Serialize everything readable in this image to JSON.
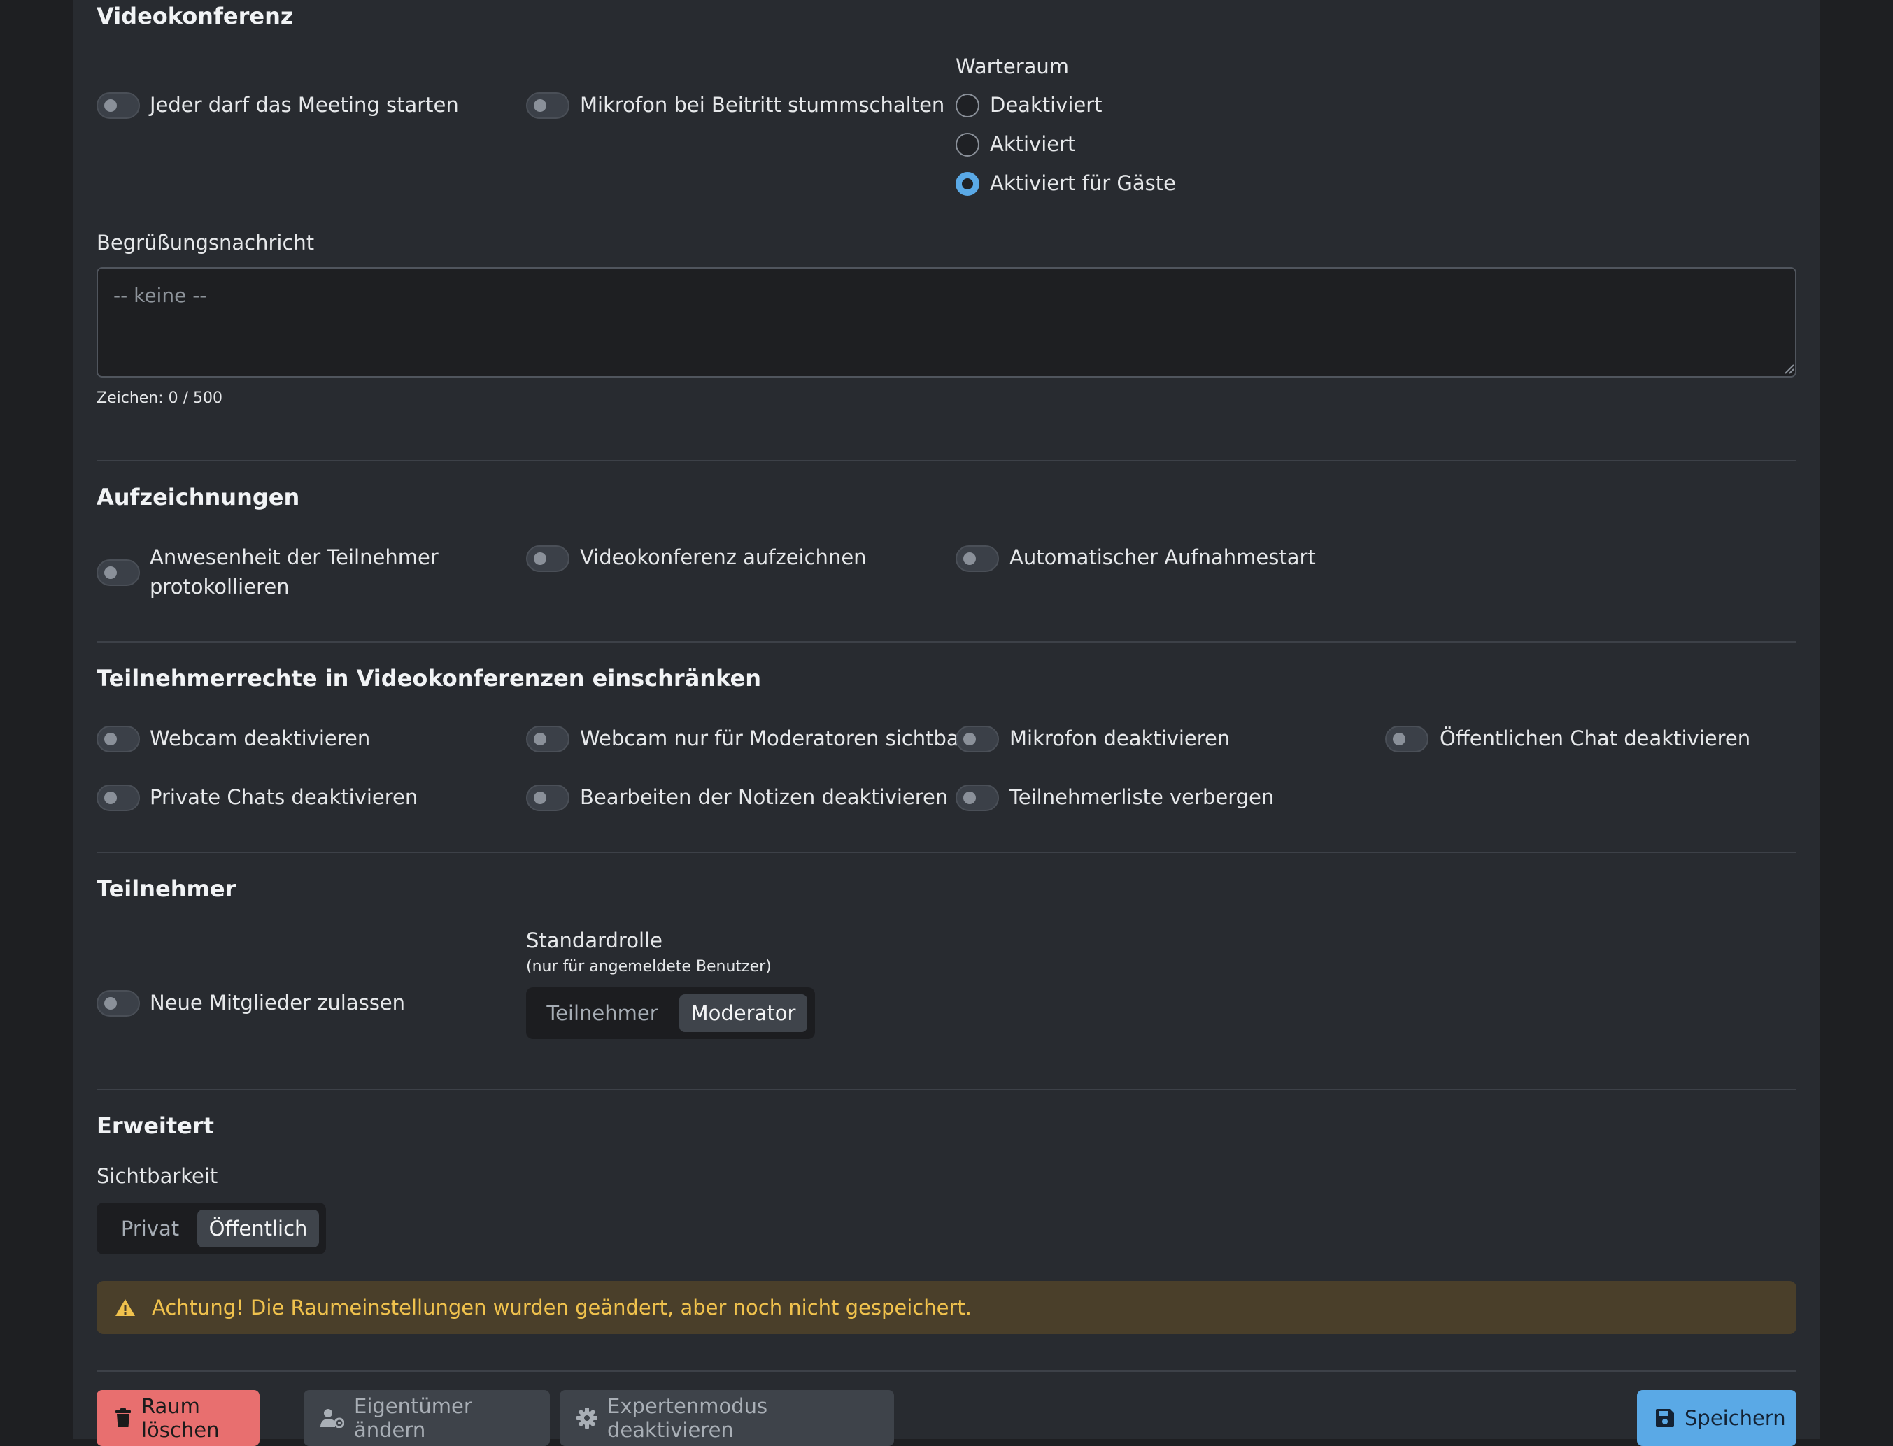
{
  "sections": {
    "videokonferenz": {
      "title": "Videokonferenz",
      "toggle_anyone_start": "Jeder darf das Meeting starten",
      "toggle_mute_on_join": "Mikrofon bei Beitritt stummschalten",
      "waiting_room": {
        "label": "Warteraum",
        "options": [
          "Deaktiviert",
          "Aktiviert",
          "Aktiviert für Gäste"
        ],
        "selected": "Aktiviert für Gäste"
      },
      "welcome": {
        "label": "Begrüßungsnachricht",
        "placeholder": "-- keine --",
        "value": "",
        "counter": "Zeichen: 0 / 500"
      }
    },
    "recordings": {
      "title": "Aufzeichnungen",
      "toggle_attendance_line1": "Anwesenheit der Teilnehmer",
      "toggle_attendance_line2": "protokollieren",
      "toggle_record": "Videokonferenz aufzeichnen",
      "toggle_auto_start": "Automatischer Aufnahmestart"
    },
    "restrictions": {
      "title": "Teilnehmerrechte in Videokonferenzen einschränken",
      "items": [
        "Webcam deaktivieren",
        "Webcam nur für Moderatoren sichtbar",
        "Mikrofon deaktivieren",
        "Öffentlichen Chat deaktivieren",
        "Private Chats deaktivieren",
        "Bearbeiten der Notizen deaktivieren",
        "Teilnehmerliste verbergen"
      ]
    },
    "participants": {
      "title": "Teilnehmer",
      "toggle_new_members": "Neue Mitglieder zulassen",
      "default_role_label": "Standardrolle",
      "default_role_hint": "(nur für angemeldete Benutzer)",
      "role_options": [
        "Teilnehmer",
        "Moderator"
      ],
      "role_selected": "Moderator"
    },
    "advanced": {
      "title": "Erweitert",
      "visibility_label": "Sichtbarkeit",
      "visibility_options": [
        "Privat",
        "Öffentlich"
      ],
      "visibility_selected": "Öffentlich"
    }
  },
  "alert": {
    "text": "Achtung! Die Raumeinstellungen wurden geändert, aber noch nicht gespeichert."
  },
  "buttons": {
    "delete": "Raum löschen",
    "change_owner": "Eigentümer ändern",
    "expert_mode": "Expertenmodus deaktivieren",
    "save": "Speichern"
  },
  "colors": {
    "accent": "#5aa9e6",
    "danger": "#e86f6f",
    "warning_text": "#f0c24d",
    "panel": "#282b30"
  },
  "icons": [
    "warning-icon",
    "trash-icon",
    "user-gear-icon",
    "gear-icon",
    "save-icon"
  ]
}
